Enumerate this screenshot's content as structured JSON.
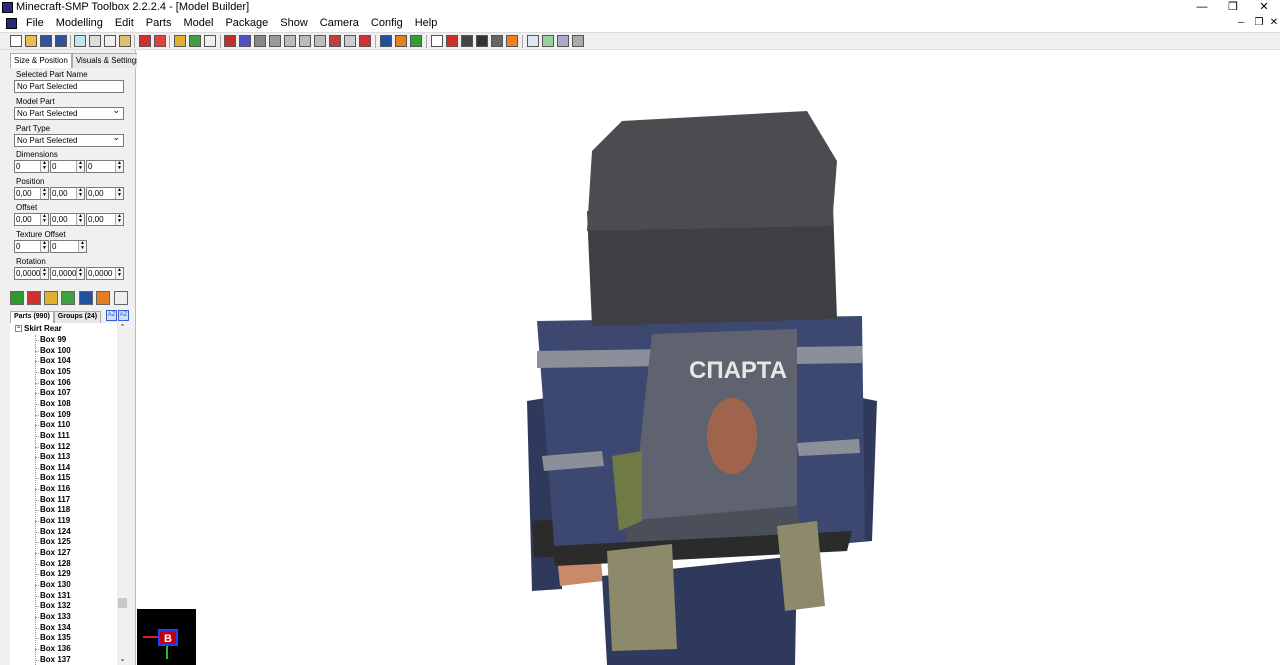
{
  "window": {
    "title": "Minecraft-SMP Toolbox 2.2.2.4 - [Model Builder]",
    "controls": [
      "—",
      "❒",
      "✕"
    ]
  },
  "menu": {
    "items": [
      "File",
      "Modelling",
      "Edit",
      "Parts",
      "Model",
      "Package",
      "Show",
      "Camera",
      "Config",
      "Help"
    ],
    "mdi_controls": [
      "–",
      "❒",
      "✕"
    ]
  },
  "left_panel": {
    "tabs": [
      "Size & Position",
      "Visuals & Settings"
    ],
    "selected_part_name": {
      "label": "Selected Part Name",
      "value": "No Part Selected"
    },
    "model_part": {
      "label": "Model Part",
      "value": "No Part Selected"
    },
    "part_type": {
      "label": "Part Type",
      "value": "No Part Selected"
    },
    "dimensions": {
      "label": "Dimensions",
      "values": [
        "0",
        "0",
        "0"
      ]
    },
    "position": {
      "label": "Position",
      "values": [
        "0,00",
        "0,00",
        "0,00"
      ]
    },
    "offset": {
      "label": "Offset",
      "values": [
        "0,00",
        "0,00",
        "0,00"
      ]
    },
    "texture_offset": {
      "label": "Texture Offset",
      "values": [
        "0",
        "0"
      ]
    },
    "rotation": {
      "label": "Rotation",
      "values": [
        "0,0000",
        "0,0000",
        "0,0000"
      ]
    },
    "parts_tabs": [
      "Parts (990)",
      "Groups (24)"
    ],
    "sort_icons": [
      "AZ",
      "AZ"
    ]
  },
  "tree": {
    "root": "Skirt Rear",
    "items": [
      "Box 99",
      "Box 100",
      "Box 104",
      "Box 105",
      "Box 106",
      "Box 107",
      "Box 108",
      "Box 109",
      "Box 110",
      "Box 111",
      "Box 112",
      "Box 113",
      "Box 114",
      "Box 115",
      "Box 116",
      "Box 117",
      "Box 118",
      "Box 119",
      "Box 124",
      "Box 125",
      "Box 127",
      "Box 128",
      "Box 129",
      "Box 130",
      "Box 131",
      "Box 132",
      "Box 133",
      "Box 134",
      "Box 135",
      "Box 136",
      "Box 137"
    ]
  },
  "viewport": {
    "model_text": "СПАРТА",
    "gizmo_label": "B"
  },
  "colors": {
    "helmet": "#3d3f42",
    "vest": "#3c4870",
    "plate": "#5f6370",
    "pouch": "#8c8a6a",
    "skin": "#c98a6a"
  }
}
